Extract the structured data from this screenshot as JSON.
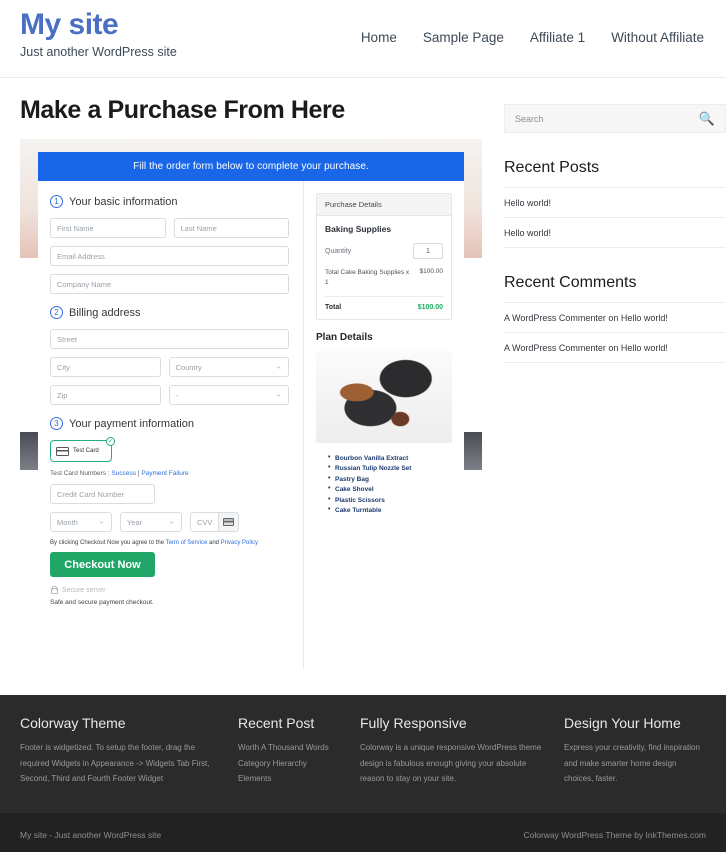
{
  "header": {
    "site_title": "My site",
    "tagline": "Just another WordPress site",
    "nav": [
      {
        "label": "Home"
      },
      {
        "label": "Sample Page"
      },
      {
        "label": "Affiliate 1"
      },
      {
        "label": "Without Affiliate"
      }
    ]
  },
  "main": {
    "page_title": "Make a Purchase From Here",
    "form": {
      "banner": "Fill the order form below to complete your purchase.",
      "step1": {
        "number": "1",
        "label": "Your basic information",
        "first_name_placeholder": "First Name",
        "last_name_placeholder": "Last Name",
        "email_placeholder": "Email Address",
        "company_placeholder": "Company Name"
      },
      "step2": {
        "number": "2",
        "label": "Billing address",
        "street_placeholder": "Street",
        "city_placeholder": "City",
        "country_placeholder": "Country",
        "zip_placeholder": "Zip",
        "state_placeholder": "-"
      },
      "step3": {
        "number": "3",
        "label": "Your payment information",
        "test_card_label": "Test Card",
        "test_numbers_prefix": "Test Card Numbers : ",
        "success_link": "Success",
        "separator": " | ",
        "failure_link": "Payment Failure",
        "card_number_placeholder": "Credit Card Number",
        "month_placeholder": "Month",
        "year_placeholder": "Year",
        "cvv_placeholder": "CVV"
      },
      "agree_prefix": "By clicking Checkout Now you agree to the ",
      "terms_link": "Term of Service",
      "agree_mid": " and ",
      "privacy_link": "Privacy Policy",
      "checkout_button": "Checkout Now",
      "secure_server": "Secure server",
      "safe_text": "Safe and secure payment checkout."
    },
    "purchase_details": {
      "header": "Purchase Details",
      "product": "Baking Supplies",
      "quantity_label": "Quantity",
      "quantity_value": "1",
      "line_item_name": "Total Cake Baking Supplies x 1",
      "line_item_amount": "$100.00",
      "total_label": "Total",
      "total_amount": "$100.00"
    },
    "plan_details": {
      "title": "Plan Details",
      "items": [
        "Bourbon Vanilla Extract",
        "Russian Tulip Nozzle Set",
        "Pastry Bag",
        "Cake Shovel",
        "Plastic Scissors",
        "Cake Turntable"
      ]
    }
  },
  "sidebar": {
    "search_placeholder": "Search",
    "recent_posts": {
      "title": "Recent Posts",
      "items": [
        "Hello world!",
        "Hello world!"
      ]
    },
    "recent_comments": {
      "title": "Recent Comments",
      "items": [
        "A WordPress Commenter on Hello world!",
        "A WordPress Commenter on Hello world!"
      ]
    }
  },
  "footer": {
    "widgets": [
      {
        "title": "Colorway Theme",
        "text": "Footer is widgetized. To setup the footer, drag the required Widgets in Appearance -> Widgets Tab First, Second, Third and Fourth Footer Widget"
      },
      {
        "title": "Recent Post",
        "links": [
          "Worth A Thousand Words",
          "Category Hierarchy",
          "Elements"
        ]
      },
      {
        "title": "Fully Responsive",
        "text": "Colorway is a unique responsive WordPress theme design is fabulous enough giving your absolute reason to stay on your site."
      },
      {
        "title": "Design Your Home",
        "text": "Express your creativity, find inspiration and make smarter home design choices, faster."
      }
    ],
    "copyright_left": "My site - Just another WordPress site",
    "copyright_right": "Colorway WordPress Theme by InkThemes.com"
  },
  "colors": {
    "brand_blue": "#4a6fc3",
    "banner_blue": "#1967e8",
    "checkout_green": "#22a668",
    "total_green": "#1dab5e",
    "footer_dark": "#2b2b2b",
    "footer_bottom": "#222222"
  }
}
